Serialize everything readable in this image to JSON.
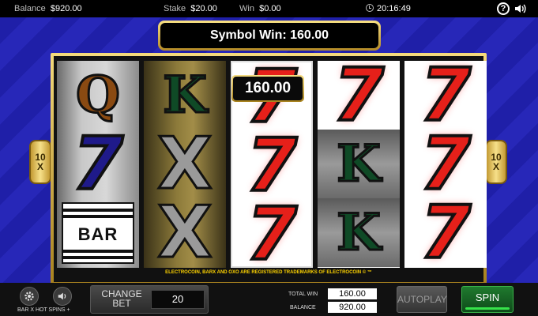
{
  "topbar": {
    "balance_label": "Balance",
    "balance_value": "$920.00",
    "stake_label": "Stake",
    "stake_value": "$20.00",
    "win_label": "Win",
    "win_value": "$0.00",
    "clock": "20:16:49",
    "help_glyph": "?"
  },
  "banner": {
    "text": "Symbol Win: 160.00"
  },
  "win_amount_label": "160.00",
  "multiplier": {
    "left_top": "10",
    "left_bottom": "X",
    "right_top": "10",
    "right_bottom": "X"
  },
  "reels": [
    {
      "symbols": [
        "Q",
        "7",
        "BAR"
      ]
    },
    {
      "symbols": [
        "K",
        "X",
        "X"
      ]
    },
    {
      "symbols": [
        "7",
        "7",
        "7"
      ]
    },
    {
      "symbols": [
        "7",
        "K",
        "K"
      ]
    },
    {
      "symbols": [
        "7",
        "7",
        "7"
      ]
    }
  ],
  "trademark": "ELECTROCOIN, BARX AND OXO ARE REGISTERED TRADEMARKS OF ELECTROCOIN © ™",
  "bottombar": {
    "game_title": "BAR X HOT SPINS +",
    "change_bet_label": "CHANGE BET",
    "bet_value": "20",
    "total_win_label": "TOTAL WIN",
    "total_win_value": "160.00",
    "balance_label": "BALANCE",
    "balance_value": "920.00",
    "autoplay_label": "AUTOPLAY",
    "spin_label": "SPIN"
  },
  "icons": [
    "clock-icon",
    "help-icon",
    "speaker-icon",
    "settings-gear-icon",
    "volume-icon"
  ],
  "colors": {
    "background": "#2222b0",
    "gold": "#f4da7c",
    "red7": "#e6201a",
    "spin_green": "#1f7a2e"
  }
}
